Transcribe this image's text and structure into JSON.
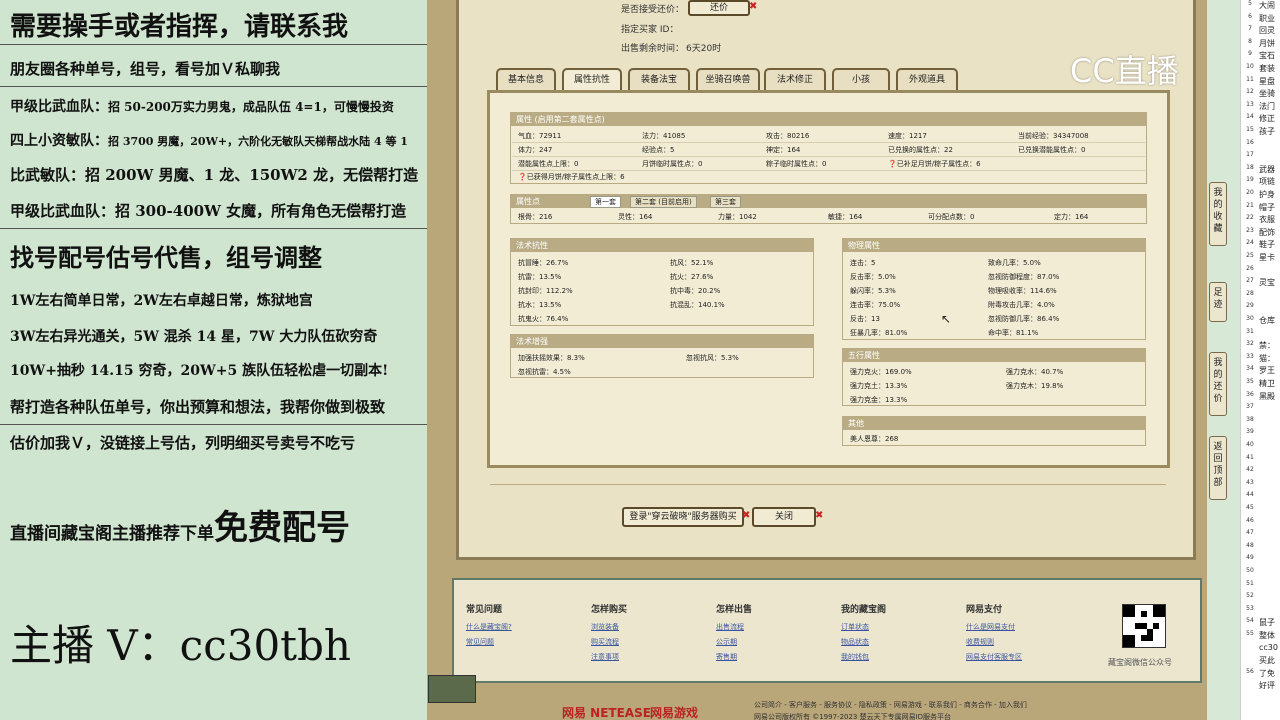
{
  "promo": {
    "l1": "需要操手或者指挥，请联系我",
    "l2": "朋友圈各种单号，组号，看号加Ｖ私聊我",
    "l3a": "甲级比武血队：",
    "l3b": "招 50-200万实力男鬼，成品队伍 4=1，可慢慢投资",
    "l4a": "四上小资敏队：",
    "l4b": "招 3700 男魔，20W+，六阶化无敏队天梯帮战水陆 4 等 1",
    "l5": "比武敏队：招 200W 男魔、1 龙、150W2 龙，无偿帮打造",
    "l6": "甲级比武血队：招 300-400W 女魔，所有角色无偿帮打造",
    "l7": "找号配号估号代售，组号调整",
    "l8": "1W左右简单日常，2W左右卓越日常，炼狱地宫",
    "l9": "3W左右异光通关，5W 混杀 14 星，7W 大力队伍砍穷奇",
    "l10": "10W+抽秒 14.15 穷奇，20W+5 族队伍轻松虐一切副本!",
    "l11": "帮打造各种队伍单号，你出预算和想法，我帮你做到极致",
    "l12": "估价加我Ｖ，没链接上号估，列明细买号卖号不吃亏",
    "l13a": "直播间藏宝阁主播推荐下单",
    "l13b": "免费配号",
    "l14": "主播 V：cc30tbh"
  },
  "game": {
    "accept_label": "是否接受还价：",
    "counter_btn": "还价",
    "buyer_label": "指定买家 ID：",
    "time_label": "出售剩余时间：",
    "time_value": "6天20时",
    "tabs": [
      "基本信息",
      "属性抗性",
      "装备法宝",
      "坐骑召唤兽",
      "法术修正",
      "小孩",
      "外观道具"
    ],
    "attr_title": "属性 (启用第二套属性点)",
    "attrs": [
      [
        "气血：72911",
        "法力：41085",
        "攻击：80216",
        "速度：1217",
        "当前经验：34347008"
      ],
      [
        "体力：247",
        "经验点：5",
        "神定：164",
        "已兑换的属性点：22",
        "已兑换潜能属性点：0"
      ],
      [
        "潜能属性点上限：0",
        "月饼临时属性点：0",
        "粽子临时属性点：0",
        "已补足月饼/粽子属性点：6"
      ]
    ],
    "attr_extra": "已获得月饼/粽子属性点上限：6",
    "points_title": "属性点",
    "points_tabs": [
      "第一套",
      "第二套 (目前启用)",
      "第三套"
    ],
    "points": [
      "根骨：216",
      "灵性：164",
      "力量：1042",
      "敏捷：164",
      "可分配点数：0",
      "定力：164"
    ],
    "spell_title": "法术抗性",
    "spell": [
      [
        "抗冒睡：26.7%",
        "抗风：52.1%"
      ],
      [
        "抗雷：13.5%",
        "抗火：27.6%"
      ],
      [
        "抗封印：112.2%",
        "抗中毒：20.2%"
      ],
      [
        "抗水：13.5%",
        "抗混乱：140.1%"
      ],
      [
        "抗鬼火：76.4%",
        ""
      ]
    ],
    "boost_title": "法术增强",
    "boost": [
      [
        "加强扶摇效果：8.3%",
        "忽视抗风：5.3%"
      ],
      [
        "忽视抗雷：4.5%",
        ""
      ]
    ],
    "phys_title": "物理属性",
    "phys": [
      [
        "连击：5",
        "致命几率：5.0%"
      ],
      [
        "反击率：5.0%",
        "忽视防御程度：87.0%"
      ],
      [
        "躲闪率：5.3%",
        "物理吸收率：114.6%"
      ],
      [
        "连击率：75.0%",
        "附毒攻击几率：4.0%"
      ],
      [
        "反击：13",
        "忽视防御几率：86.4%"
      ],
      [
        "狂暴几率：81.0%",
        "命中率：81.1%"
      ]
    ],
    "five_title": "五行属性",
    "five": [
      [
        "强力克火：169.0%",
        "强力克水：40.7%"
      ],
      [
        "强力克土：13.3%",
        "强力克木：19.8%"
      ],
      [
        "强力克金：13.3%",
        ""
      ]
    ],
    "other_title": "其他",
    "other": "美人恩尊：268",
    "login_btn": "登录\"穿云破晓\"服务器购买",
    "close_btn": "关闭"
  },
  "footer": {
    "cols": [
      {
        "h": "常见问题",
        "links": [
          "什么是藏宝阁?",
          "常见问题"
        ]
      },
      {
        "h": "怎样购买",
        "links": [
          "浏览装备",
          "购买流程",
          "注意事项"
        ]
      },
      {
        "h": "怎样出售",
        "links": [
          "出售流程",
          "公示期",
          "寄售期"
        ]
      },
      {
        "h": "我的藏宝阁",
        "links": [
          "订单状态",
          "物品状态",
          "我的钱包"
        ]
      },
      {
        "h": "网易支付",
        "links": [
          "什么是网易支付",
          "收费规则",
          "网易支付客服专区"
        ]
      }
    ],
    "qr_caption": "藏宝阁微信公众号",
    "bottom_links": "公司简介 - 客户服务 - 服务协议 - 隐私政策 - 网易游戏 - 联系我们 - 商务合作 - 加入我们",
    "copyright": "网易公司版权所有 ©1997-2023  楚云天下专属网易ID服务平台",
    "netease": "网易 NETEASE",
    "netease_games": "网易游戏"
  },
  "vnav": [
    "我的收藏",
    "足迹",
    "我的还价",
    "返回顶部"
  ],
  "logo": "CC直播",
  "sheet": {
    "rows": [
      [
        "5",
        "大闹"
      ],
      [
        "6",
        "职业"
      ],
      [
        "7",
        "回灵"
      ],
      [
        "8",
        "月饼"
      ],
      [
        "9",
        "宝石"
      ],
      [
        "10",
        "套装"
      ],
      [
        "11",
        "星盘"
      ],
      [
        "12",
        "坐骑"
      ],
      [
        "13",
        "法门"
      ],
      [
        "14",
        "修正"
      ],
      [
        "15",
        "孩子"
      ],
      [
        "16",
        ""
      ],
      [
        "17",
        ""
      ],
      [
        "18",
        "武器"
      ],
      [
        "19",
        "项链"
      ],
      [
        "20",
        "护身"
      ],
      [
        "21",
        "帽子"
      ],
      [
        "22",
        "衣服"
      ],
      [
        "23",
        "配饰"
      ],
      [
        "24",
        "鞋子"
      ],
      [
        "25",
        "星卡"
      ],
      [
        "26",
        ""
      ],
      [
        "27",
        "灵宝"
      ],
      [
        "28",
        ""
      ],
      [
        "29",
        ""
      ],
      [
        "30",
        "仓库"
      ],
      [
        "31",
        ""
      ],
      [
        "32",
        "禁："
      ],
      [
        "33",
        "猫："
      ],
      [
        "34",
        "罗王"
      ],
      [
        "35",
        "精卫"
      ],
      [
        "36",
        "黑殿"
      ],
      [
        "37",
        ""
      ],
      [
        "38",
        ""
      ],
      [
        "39",
        ""
      ],
      [
        "40",
        ""
      ],
      [
        "41",
        ""
      ],
      [
        "42",
        ""
      ],
      [
        "43",
        ""
      ],
      [
        "44",
        ""
      ],
      [
        "45",
        ""
      ],
      [
        "46",
        ""
      ],
      [
        "47",
        ""
      ],
      [
        "48",
        ""
      ],
      [
        "49",
        ""
      ],
      [
        "50",
        ""
      ],
      [
        "51",
        ""
      ],
      [
        "52",
        ""
      ],
      [
        "53",
        ""
      ],
      [
        "54",
        "鼠子"
      ],
      [
        "55",
        "整体"
      ],
      [
        "",
        "cc30"
      ],
      [
        "",
        "买此"
      ],
      [
        "56",
        "了免"
      ],
      [
        "",
        "好评"
      ]
    ]
  }
}
